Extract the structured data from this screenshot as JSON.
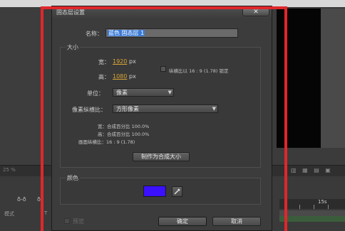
{
  "background": {
    "zoom_label": "25 %",
    "zoom_right": "▥ ▦ ▤ ▣",
    "tool_icons": [
      "ð-ð",
      "ð"
    ],
    "mode_label": "模式",
    "t_label": "T",
    "time_label": "15s"
  },
  "dialog": {
    "title": "固态层设置",
    "close_label": "✕",
    "name": {
      "label": "名称：",
      "value": "蓝色 固态层 1"
    },
    "size": {
      "section_label": "大小",
      "width_label": "宽：",
      "width_value": "1920",
      "height_label": "高：",
      "height_value": "1080",
      "unit_px": "px",
      "lock_label": "纵横比以 16 : 9 (1.78) 锁定",
      "units_label": "单位：",
      "units_value": "像素",
      "pixel_aspect_label": "像素纵横比：",
      "pixel_aspect_value": "方形像素",
      "info_width": "宽：合成百分比 100.0%",
      "info_height": "高：合成百分比 100.0%",
      "info_frame_aspect": "画面纵横比：16 : 9 (1.78)",
      "make_comp_size": "制作为合成大小"
    },
    "color": {
      "section_label": "颜色",
      "swatch_hex": "#3a10ff"
    },
    "preview_label": "预览",
    "ok_label": "确定",
    "cancel_label": "取消"
  },
  "highlight_color": "#e0272b"
}
